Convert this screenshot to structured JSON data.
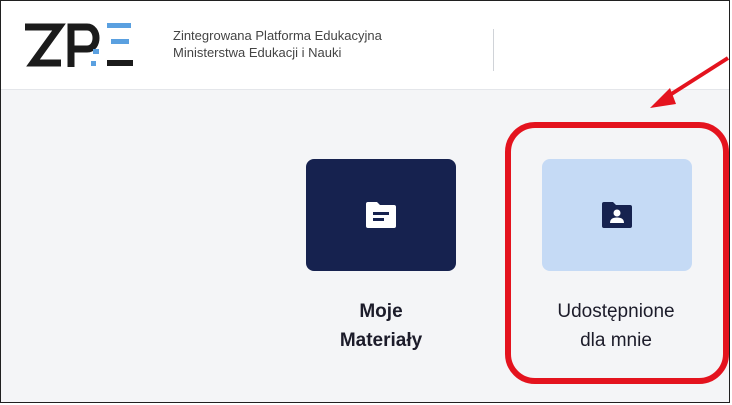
{
  "header": {
    "logo_text": "ZPE",
    "subtitle_line1": "Zintegrowana Platforma Edukacyjna",
    "subtitle_line2": "Ministerstwa Edukacji i Nauki"
  },
  "tiles": [
    {
      "line1": "Moje",
      "line2": "Materiały",
      "icon": "folder-document-icon",
      "color": "#16224f"
    },
    {
      "line1": "Udostępnione",
      "line2": "dla mnie",
      "icon": "folder-shared-user-icon",
      "color": "#c5daf5"
    }
  ],
  "annotation": {
    "highlight_color": "#e4131e"
  }
}
